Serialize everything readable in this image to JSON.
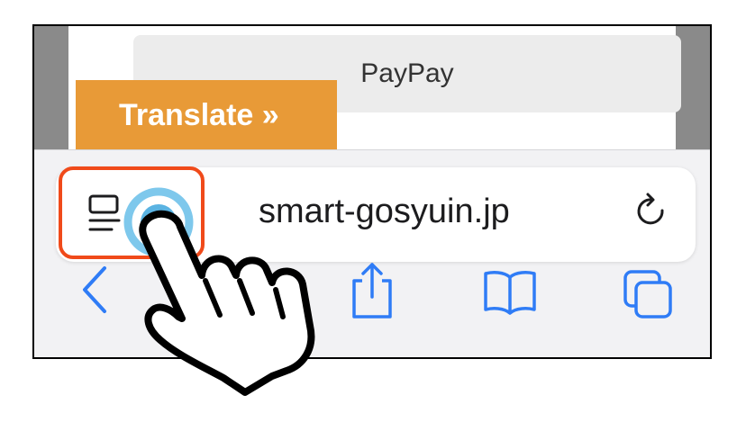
{
  "page": {
    "payment_button": "PayPay",
    "translate_button": "Translate »"
  },
  "address_bar": {
    "url": "smart-gosyuin.jp",
    "left_icon": "reader-mode-icon",
    "right_icon": "reload-icon"
  },
  "bottom_toolbar": {
    "icons": [
      "back-icon",
      "share-icon",
      "bookmarks-icon",
      "tabs-icon"
    ]
  },
  "colors": {
    "translate_bg": "#e89a37",
    "highlight_border": "#f04a1a",
    "ios_blue": "#2f7cf6",
    "tap_ring": "#7ec8ec"
  }
}
